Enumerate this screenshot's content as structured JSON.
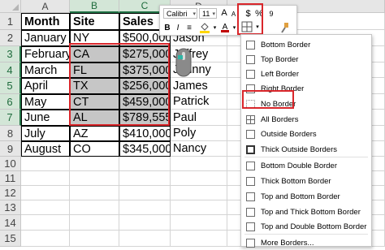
{
  "columns": [
    "A",
    "B",
    "C",
    "D"
  ],
  "rows": [
    "1",
    "2",
    "3",
    "4",
    "5",
    "6",
    "7",
    "8",
    "9",
    "10",
    "11",
    "12",
    "13",
    "14",
    "15"
  ],
  "table": [
    [
      "Month",
      "Site",
      "Sales",
      ""
    ],
    [
      "January",
      "NY",
      "$500,000",
      "Jason"
    ],
    [
      "February",
      "CA",
      "$275,000",
      "Jeffrey"
    ],
    [
      "March",
      "FL",
      "$375,000",
      "Johnny"
    ],
    [
      "April",
      "TX",
      "$256,000",
      "James"
    ],
    [
      "May",
      "CT",
      "$459,000",
      "Patrick"
    ],
    [
      "June",
      "AL",
      "$789,555",
      "Paul"
    ],
    [
      "July",
      "AZ",
      "$410,000",
      "Poly"
    ],
    [
      "August",
      "CO",
      "$345,000",
      "Nancy"
    ]
  ],
  "mini_toolbar": {
    "font": "Calibri",
    "size": "11",
    "buttons": [
      "A",
      "A",
      "$",
      "%",
      "9",
      "B",
      "I",
      "≡",
      "A"
    ],
    "colors": {
      "font": "#c00000",
      "highlight": "#ffd700"
    }
  },
  "border_menu": {
    "items": [
      "Bottom Border",
      "Top Border",
      "Left Border",
      "Right Border",
      "No Border",
      "All Borders",
      "Outside Borders",
      "Thick Outside Borders",
      "Bottom Double Border",
      "Thick Bottom Border",
      "Top and Bottom Border",
      "Top and Thick Bottom Border",
      "Top and Double Bottom Border",
      "More Borders..."
    ],
    "highlighted": "No Border"
  },
  "colors": {
    "accent": "#217346",
    "highlight_box": "#d9262b",
    "selection_shade": "#c6c6c6"
  }
}
